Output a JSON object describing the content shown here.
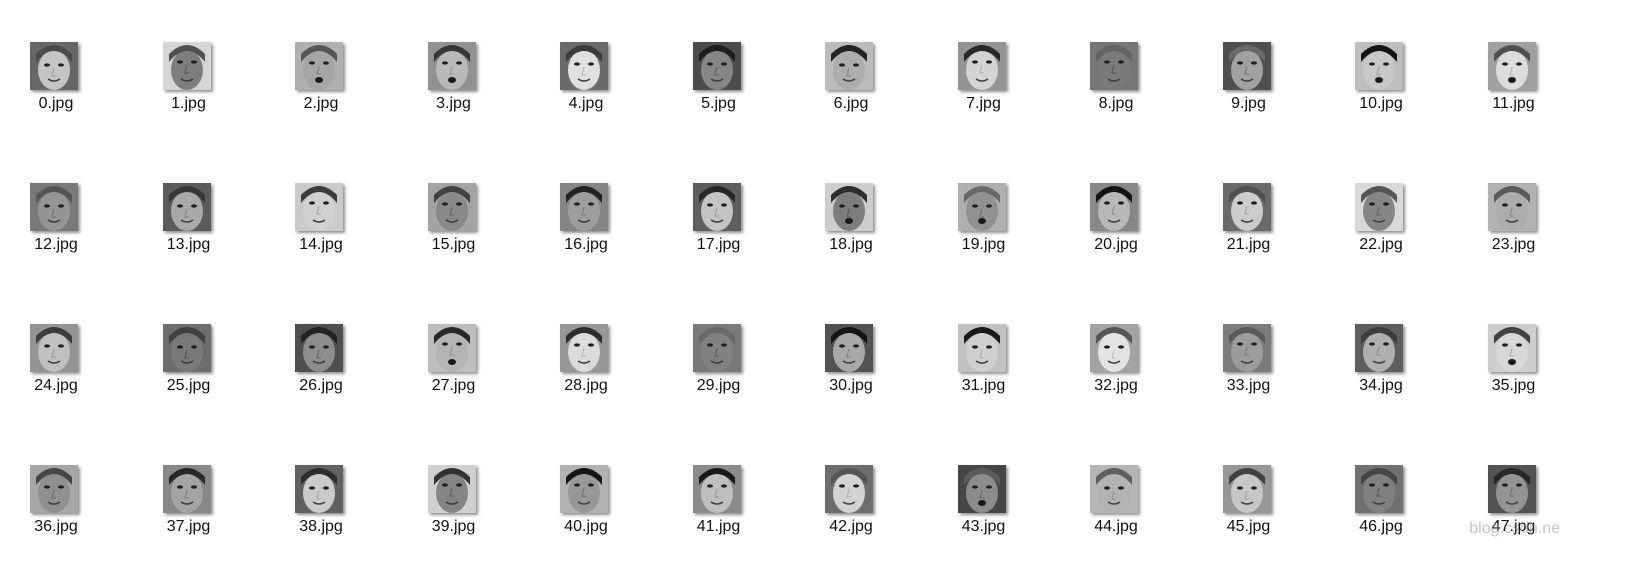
{
  "files": [
    {
      "name": "0.jpg"
    },
    {
      "name": "1.jpg"
    },
    {
      "name": "2.jpg"
    },
    {
      "name": "3.jpg"
    },
    {
      "name": "4.jpg"
    },
    {
      "name": "5.jpg"
    },
    {
      "name": "6.jpg"
    },
    {
      "name": "7.jpg"
    },
    {
      "name": "8.jpg"
    },
    {
      "name": "9.jpg"
    },
    {
      "name": "10.jpg"
    },
    {
      "name": "11.jpg"
    },
    {
      "name": "12.jpg"
    },
    {
      "name": "13.jpg"
    },
    {
      "name": "14.jpg"
    },
    {
      "name": "15.jpg"
    },
    {
      "name": "16.jpg"
    },
    {
      "name": "17.jpg"
    },
    {
      "name": "18.jpg"
    },
    {
      "name": "19.jpg"
    },
    {
      "name": "20.jpg"
    },
    {
      "name": "21.jpg"
    },
    {
      "name": "22.jpg"
    },
    {
      "name": "23.jpg"
    },
    {
      "name": "24.jpg"
    },
    {
      "name": "25.jpg"
    },
    {
      "name": "26.jpg"
    },
    {
      "name": "27.jpg"
    },
    {
      "name": "28.jpg"
    },
    {
      "name": "29.jpg"
    },
    {
      "name": "30.jpg"
    },
    {
      "name": "31.jpg"
    },
    {
      "name": "32.jpg"
    },
    {
      "name": "33.jpg"
    },
    {
      "name": "34.jpg"
    },
    {
      "name": "35.jpg"
    },
    {
      "name": "36.jpg"
    },
    {
      "name": "37.jpg"
    },
    {
      "name": "38.jpg"
    },
    {
      "name": "39.jpg"
    },
    {
      "name": "40.jpg"
    },
    {
      "name": "41.jpg"
    },
    {
      "name": "42.jpg"
    },
    {
      "name": "43.jpg"
    },
    {
      "name": "44.jpg"
    },
    {
      "name": "45.jpg"
    },
    {
      "name": "46.jpg"
    },
    {
      "name": "47.jpg"
    }
  ],
  "watermark": "blog.csdn.ne"
}
